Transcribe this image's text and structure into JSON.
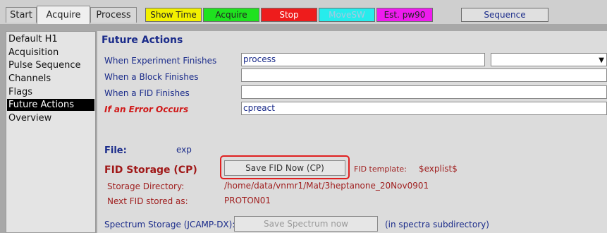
{
  "tabs": [
    {
      "label": "Start"
    },
    {
      "label": "Acquire"
    },
    {
      "label": "Process"
    }
  ],
  "commands": [
    {
      "label": "Show Time",
      "bg": "#f2f000",
      "fg": "#222222"
    },
    {
      "label": "Acquire",
      "bg": "#1fe21f",
      "fg": "#222222"
    },
    {
      "label": "Stop",
      "bg": "#ee1c1c",
      "fg": "#ffffff"
    },
    {
      "label": "MoveSW",
      "bg": "#27ecec",
      "fg": "#a8c8e0"
    },
    {
      "label": "Est. pw90",
      "bg": "#ee1cee",
      "fg": "#222222"
    },
    {
      "label": "Sequence",
      "bg": "#e0e0e0",
      "fg": "#1a2b8a"
    }
  ],
  "sidebar": {
    "items": [
      {
        "label": "Default H1"
      },
      {
        "label": "Acquisition"
      },
      {
        "label": "Pulse Sequence"
      },
      {
        "label": "Channels"
      },
      {
        "label": "Flags"
      },
      {
        "label": "Future Actions"
      },
      {
        "label": "Overview"
      }
    ]
  },
  "main": {
    "section_title": "Future Actions",
    "rows": [
      {
        "label": "When Experiment Finishes",
        "value": "process"
      },
      {
        "label": "When a Block Finishes",
        "value": ""
      },
      {
        "label": "When a FID Finishes",
        "value": ""
      },
      {
        "label": "If an Error Occurs",
        "value": "cpreact"
      }
    ],
    "file_label": "File:",
    "file_value": "exp",
    "fid_storage_title": "FID Storage (CP)",
    "save_fid_button": "Save FID Now (CP)",
    "fid_template_label": "FID template:",
    "fid_template_value": "$explist$",
    "storage_dir_label": "Storage Directory:",
    "storage_dir_value": "/home/data/vnmr1/Mat/3heptanone_20Nov0901",
    "next_fid_label": "Next FID stored as:",
    "next_fid_value": "PROTON01",
    "spectrum_storage_label": "Spectrum Storage (JCAMP-DX):",
    "save_spectrum_button": "Save Spectrum now",
    "spectra_note": "(in spectra subdirectory)"
  },
  "colors": {
    "highlight": "#e02020"
  }
}
